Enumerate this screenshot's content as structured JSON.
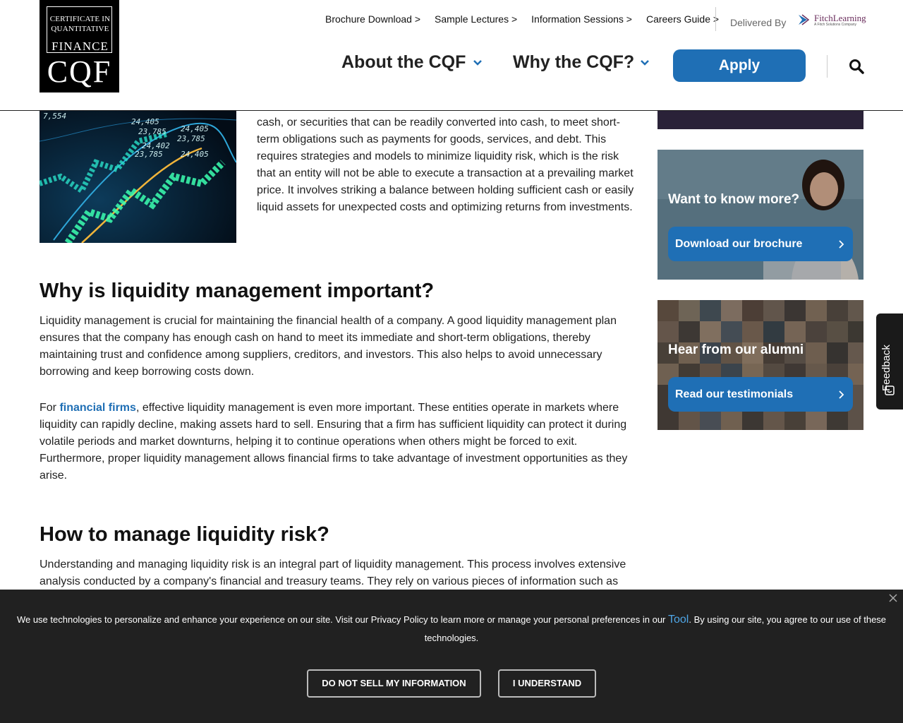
{
  "header": {
    "logo": {
      "cert_line1": "CERTIFICATE IN",
      "cert_line2": "QUANTITATIVE",
      "finance": "FINANCE",
      "cqf": "CQF"
    },
    "top_links": [
      "Brochure Download >",
      "Sample Lectures >",
      "Information Sessions >",
      "Careers Guide >"
    ],
    "delivered_by": "Delivered By",
    "partner_logo": {
      "name": "FitchLearning",
      "sub": "A Fitch Solutions Company"
    },
    "nav": {
      "about": "About the CQF",
      "why": "Why the CQF?",
      "apply": "Apply"
    },
    "icons": {
      "search": "search-icon",
      "chevron": "chevron-down-icon"
    }
  },
  "content": {
    "intro": "cash, or securities that can be readily converted into cash, to meet short-term obligations such as payments for goods, services, and debt. This requires strategies and models to minimize liquidity risk, which is the risk that an entity will not be able to execute a transaction at a prevailing market price. It involves striking a balance between holding sufficient cash or easily liquid assets for unexpected costs and optimizing returns from investments.",
    "h2_important": "Why is liquidity management important?",
    "p_important": "Liquidity management is crucial for maintaining the financial health of a company. A good liquidity management plan ensures that the company has enough cash on hand to meet its immediate and short-term obligations, thereby maintaining trust and confidence among suppliers, creditors, and investors. This also helps to avoid unnecessary borrowing and keep borrowing costs down.",
    "p_firms_prefix": "For ",
    "p_firms_link": "financial firms",
    "p_firms_rest": ", effective liquidity management is even more important. These entities operate in markets where liquidity can rapidly decline, making assets hard to sell. Ensuring that a firm has sufficient liquidity can protect it during volatile periods and market downturns, helping it to continue operations when others might be forced to exit. Furthermore, proper liquidity management allows financial firms to take advantage of investment opportunities as they arise.",
    "h2_manage": "How to manage liquidity risk?",
    "p_manage": "Understanding and managing liquidity risk is an integral part of liquidity management. This process involves extensive analysis conducted by a company's financial and treasury teams. They rely on various pieces of information such as"
  },
  "sidebar": {
    "card1": {
      "title": "Want to know more?",
      "button": "Download our brochure"
    },
    "card2": {
      "title": "Hear from our alumni",
      "button": "Read our testimonials"
    },
    "feedback": "Feedback"
  },
  "cookie": {
    "text_before": "We use technologies to personalize and enhance your experience on our site. Visit our Privacy Policy to learn more or manage your personal preferences in our ",
    "tool": "Tool",
    "text_after": ". By using our site, you agree to our use of these technologies.",
    "btn_dns": "DO NOT SELL MY INFORMATION",
    "btn_ok": "I UNDERSTAND"
  },
  "colors": {
    "accent": "#1f6fb5",
    "banner": "#212121",
    "link": "#4fa6e6"
  }
}
